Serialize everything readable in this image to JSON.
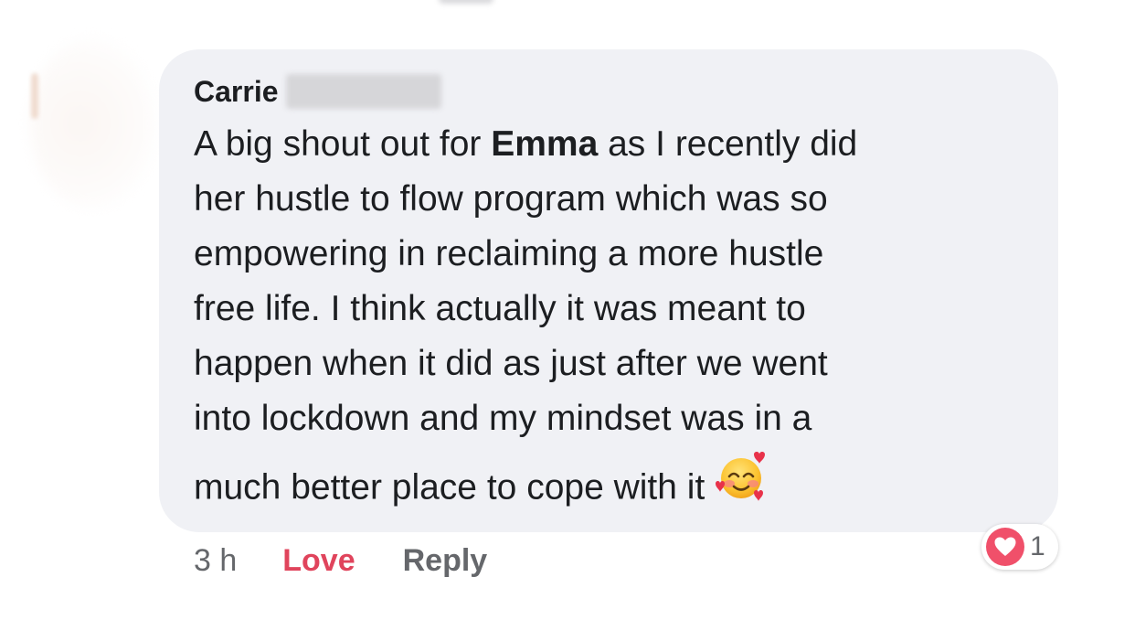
{
  "comment": {
    "author": "Carrie",
    "mention": "Emma",
    "text_lines": [
      {
        "before": "A big shout out for ",
        "after": " as I recently did"
      },
      {
        "text": "her hustle to flow program which was so"
      },
      {
        "text": "empowering in reclaiming a more hustle"
      },
      {
        "text": "free life.  I think actually it was meant to"
      },
      {
        "text": "happen when it did as just after we went"
      },
      {
        "text": "into lockdown and my mindset was in a"
      },
      {
        "text": "much better place to cope with it"
      }
    ],
    "emoji_icon": "smiling-face-with-hearts-icon"
  },
  "meta": {
    "timestamp": "3 h",
    "love_label": "Love",
    "reply_label": "Reply"
  },
  "reactions": {
    "icon": "heart-icon",
    "count": "1"
  },
  "colors": {
    "bubble": "#f0f1f5",
    "love": "#e0445c",
    "secondary_text": "#65676b"
  }
}
